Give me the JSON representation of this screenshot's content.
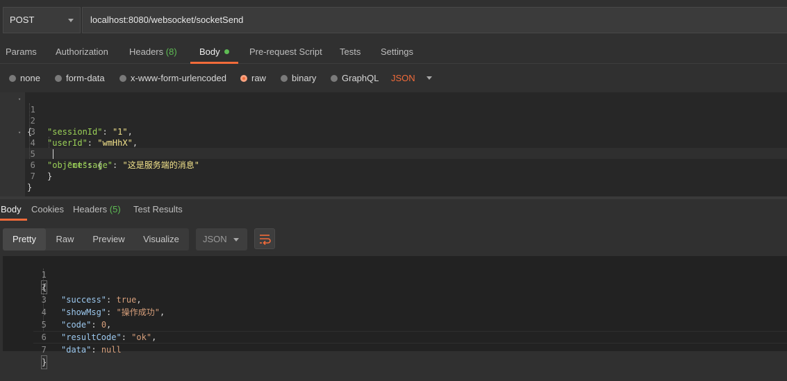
{
  "request": {
    "method": "POST",
    "url": "localhost:8080/websocket/socketSend"
  },
  "request_tabs": [
    {
      "label": "Params"
    },
    {
      "label": "Authorization"
    },
    {
      "label": "Headers",
      "count": "(8)"
    },
    {
      "label": "Body",
      "active": true
    },
    {
      "label": "Pre-request Script"
    },
    {
      "label": "Tests"
    },
    {
      "label": "Settings"
    }
  ],
  "body_types": [
    {
      "label": "none",
      "checked": false
    },
    {
      "label": "form-data",
      "checked": false
    },
    {
      "label": "x-www-form-urlencoded",
      "checked": false
    },
    {
      "label": "raw",
      "checked": true
    },
    {
      "label": "binary",
      "checked": false
    },
    {
      "label": "GraphQL",
      "checked": false
    }
  ],
  "raw_format": "JSON",
  "request_body": {
    "line_numbers": [
      "1",
      "2",
      "3",
      "4",
      "5",
      "6",
      "7"
    ],
    "open_brace": "{",
    "close_brace": "}",
    "session_key": "\"sessionId\"",
    "session_val": "\"1\"",
    "user_key": "\"userId\"",
    "user_val": "\"wmHhX\"",
    "object_key": "\"object\"",
    "message_key": "\"message\"",
    "message_val": "\"这是服务端的消息\""
  },
  "response_tabs": [
    {
      "label": "Body",
      "active": true
    },
    {
      "label": "Cookies"
    },
    {
      "label": "Headers",
      "count": "(5)"
    },
    {
      "label": "Test Results"
    }
  ],
  "response_view": {
    "modes": [
      "Pretty",
      "Raw",
      "Preview",
      "Visualize"
    ],
    "active_mode": "Pretty",
    "format": "JSON"
  },
  "response_body": {
    "line_numbers": [
      "1",
      "2",
      "3",
      "4",
      "5",
      "6",
      "7"
    ],
    "open_brace": "{",
    "close_brace": "}",
    "success_key": "\"success\"",
    "success_val": "true",
    "showmsg_key": "\"showMsg\"",
    "showmsg_val": "\"操作成功\"",
    "code_key": "\"code\"",
    "code_val": "0",
    "resultcode_key": "\"resultCode\"",
    "resultcode_val": "\"ok\"",
    "data_key": "\"data\"",
    "data_val": "null"
  },
  "colors": {
    "accent": "#f26b3a",
    "count_green": "#5ebc54"
  },
  "icons": {
    "method_dropdown": "chevron-down-icon",
    "format_dropdown": "chevron-down-icon",
    "wrap": "wrap-lines-icon",
    "fold": "fold-arrow-icon"
  }
}
